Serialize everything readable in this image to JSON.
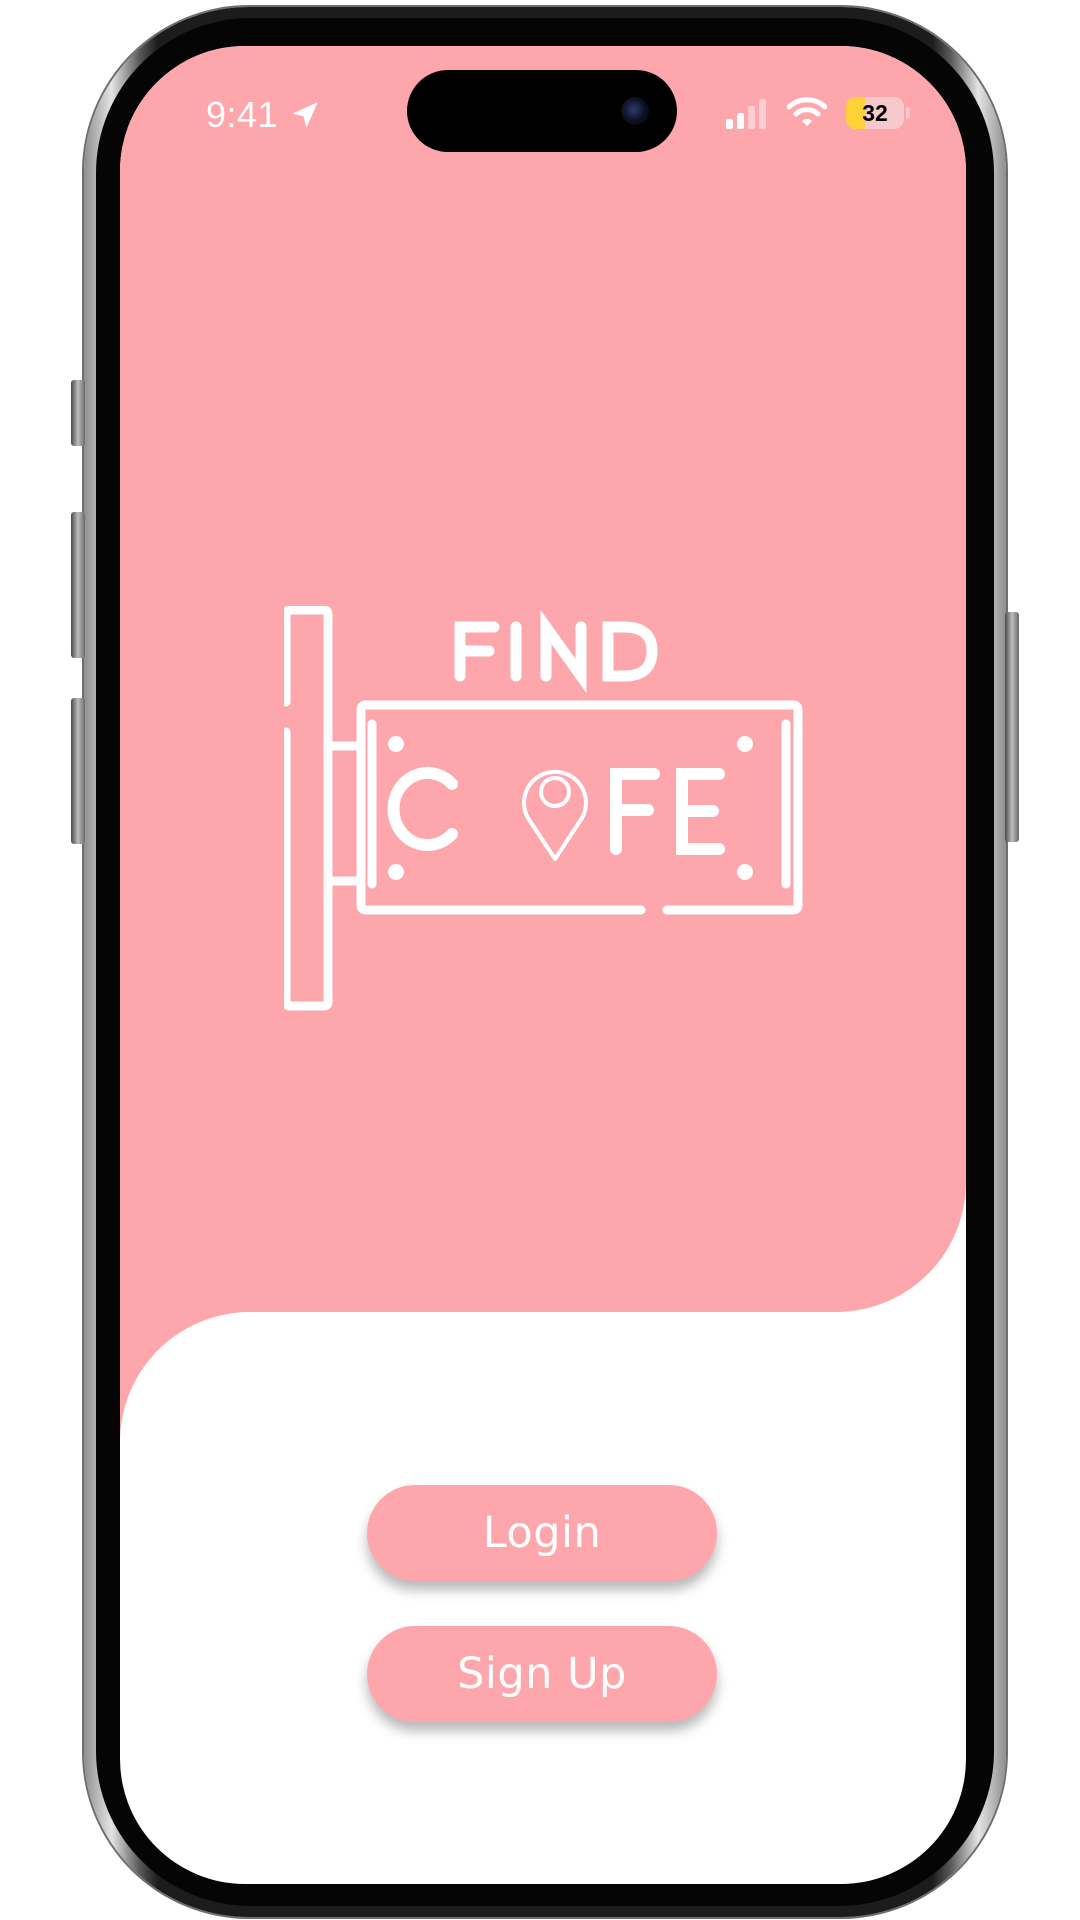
{
  "theme": {
    "accent": "#fda7ad",
    "screen_background": "#ffffff",
    "button_text": "#ffffff"
  },
  "status_bar": {
    "time": "9:41",
    "location_icon": "location-arrow-icon",
    "signal_icon": "cellular-signal-icon",
    "wifi_icon": "wifi-icon",
    "battery_level": 32,
    "battery_label": "32"
  },
  "logo": {
    "wordmark": "FIND CAFE",
    "icon": "hanging-sign-icon",
    "pin_icon": "map-pin-icon"
  },
  "actions": {
    "login_label": "Login",
    "signup_label": "Sign Up"
  }
}
